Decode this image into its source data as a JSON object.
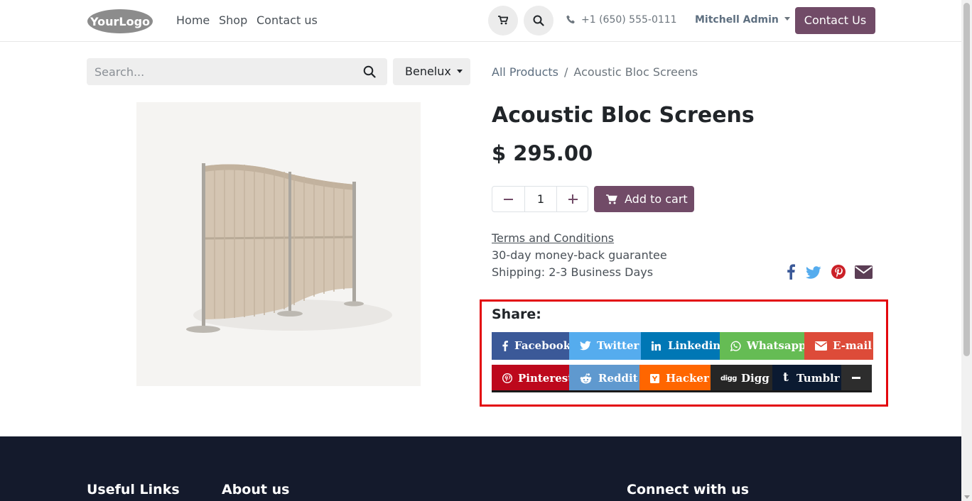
{
  "header": {
    "logo_text": "YourLogo",
    "nav": [
      "Home",
      "Shop",
      "Contact us"
    ],
    "phone": "+1 (650) 555-0111",
    "user": "Mitchell Admin",
    "contact_button": "Contact Us"
  },
  "search": {
    "placeholder": "Search...",
    "value": ""
  },
  "pricelist": "Benelux",
  "breadcrumb": {
    "parent": "All Products",
    "separator": "/",
    "current": "Acoustic Bloc Screens"
  },
  "product": {
    "name": "Acoustic Bloc Screens",
    "price": "$ 295.00",
    "quantity": "1",
    "add_to_cart": "Add to cart",
    "terms": "Terms and Conditions",
    "guarantee": "30-day money-back guarantee",
    "shipping": "Shipping: 2-3 Business Days"
  },
  "share": {
    "title": "Share:",
    "buttons": [
      {
        "label": "Facebook",
        "icon": "facebook-icon",
        "color": "#3b5998"
      },
      {
        "label": "Twitter",
        "icon": "twitter-icon",
        "color": "#55acee"
      },
      {
        "label": "Linkedin",
        "icon": "linkedin-icon",
        "color": "#0077b5"
      },
      {
        "label": "Whatsapp",
        "icon": "whatsapp-icon",
        "color": "#65bc54"
      },
      {
        "label": "E-mail",
        "icon": "envelope-icon",
        "color": "#dd4b39"
      },
      {
        "label": "Pinterest",
        "icon": "pinterest-icon",
        "color": "#bd081c"
      },
      {
        "label": "Reddit",
        "icon": "reddit-icon",
        "color": "#5f99cf"
      },
      {
        "label": "Hacker",
        "icon": "hacker-news-icon",
        "color": "#ff6600"
      },
      {
        "label": "Digg",
        "icon": "digg-icon",
        "color": "#262626"
      },
      {
        "label": "Tumblr",
        "icon": "tumblr-icon",
        "color": "#32506d"
      },
      {
        "label": "",
        "icon": "minus-icon",
        "color": "#2d2d2d"
      }
    ]
  },
  "footer": {
    "headings": [
      "Useful Links",
      "About us",
      "Connect with us"
    ]
  }
}
